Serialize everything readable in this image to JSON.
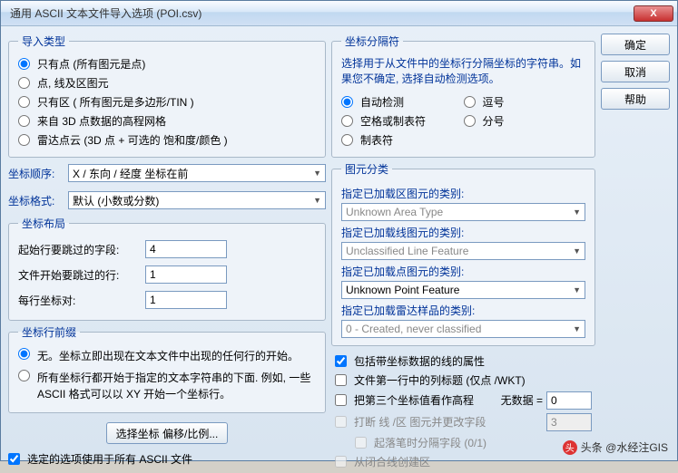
{
  "window": {
    "title": "通用 ASCII 文本文件导入选项 (POI.csv)"
  },
  "buttons": {
    "ok": "确定",
    "cancel": "取消",
    "help": "帮助",
    "offset": "选择坐标 偏移/比例..."
  },
  "importType": {
    "legend": "导入类型",
    "opt1": "只有点 (所有图元是点)",
    "opt2": "点, 线及区图元",
    "opt3": "只有区 ( 所有图元是多边形/TIN )",
    "opt4": "来自 3D 点数据的高程网格",
    "opt5": "雷达点云 (3D 点 + 可选的 饱和度/颜色 )"
  },
  "coordDelim": {
    "legend": "坐标分隔符",
    "hint": "选择用于从文件中的坐标行分隔坐标的字符串。如果您不确定, 选择自动检测选项。",
    "opt1": "自动检测",
    "opt2": "逗号",
    "opt3": "空格或制表符",
    "opt4": "分号",
    "opt5": "制表符"
  },
  "coordOrder": {
    "label": "坐标顺序:",
    "value": "X / 东向 / 经度  坐标在前"
  },
  "coordFormat": {
    "label": "坐标格式:",
    "value": "默认 (小数或分数)"
  },
  "layout": {
    "legend": "坐标布局",
    "skipFields": "起始行要跳过的字段:",
    "skipFieldsVal": "4",
    "skipLines": "文件开始要跳过的行:",
    "skipLinesVal": "1",
    "pairs": "每行坐标对:",
    "pairsVal": "1"
  },
  "prefix": {
    "legend": "坐标行前缀",
    "opt1": "无。坐标立即出现在文本文件中出现的任何行的开始。",
    "opt2": "所有坐标行都开始于指定的文本字符串的下面. 例如, 一些 ASCII 格式可以以 XY 开始一个坐标行。"
  },
  "classify": {
    "legend": "图元分类",
    "areaLabel": "指定已加载区图元的类别:",
    "areaVal": "Unknown Area Type",
    "lineLabel": "指定已加载线图元的类别:",
    "lineVal": "Unclassified Line Feature",
    "pointLabel": "指定已加载点图元的类别:",
    "pointVal": "Unknown Point Feature",
    "lidarLabel": "指定已加载雷达样品的类别:",
    "lidarVal": "0 - Created, never classified"
  },
  "opts": {
    "c1": "包括带坐标数据的线的属性",
    "c2": "文件第一行中的列标题 (仅点 /WKT)",
    "c3": "把第三个坐标值看作高程",
    "nodata": "无数据 =",
    "nodataVal": "0",
    "c4": "打断 线 /区 图元并更改字段",
    "c4val": "3",
    "c5": "起落笔时分隔字段 (0/1)",
    "c6": "从闭合线创建区"
  },
  "footer": {
    "applyAll": "选定的选项使用于所有 ASCII 文件"
  },
  "watermark": "头条 @水经注GIS"
}
